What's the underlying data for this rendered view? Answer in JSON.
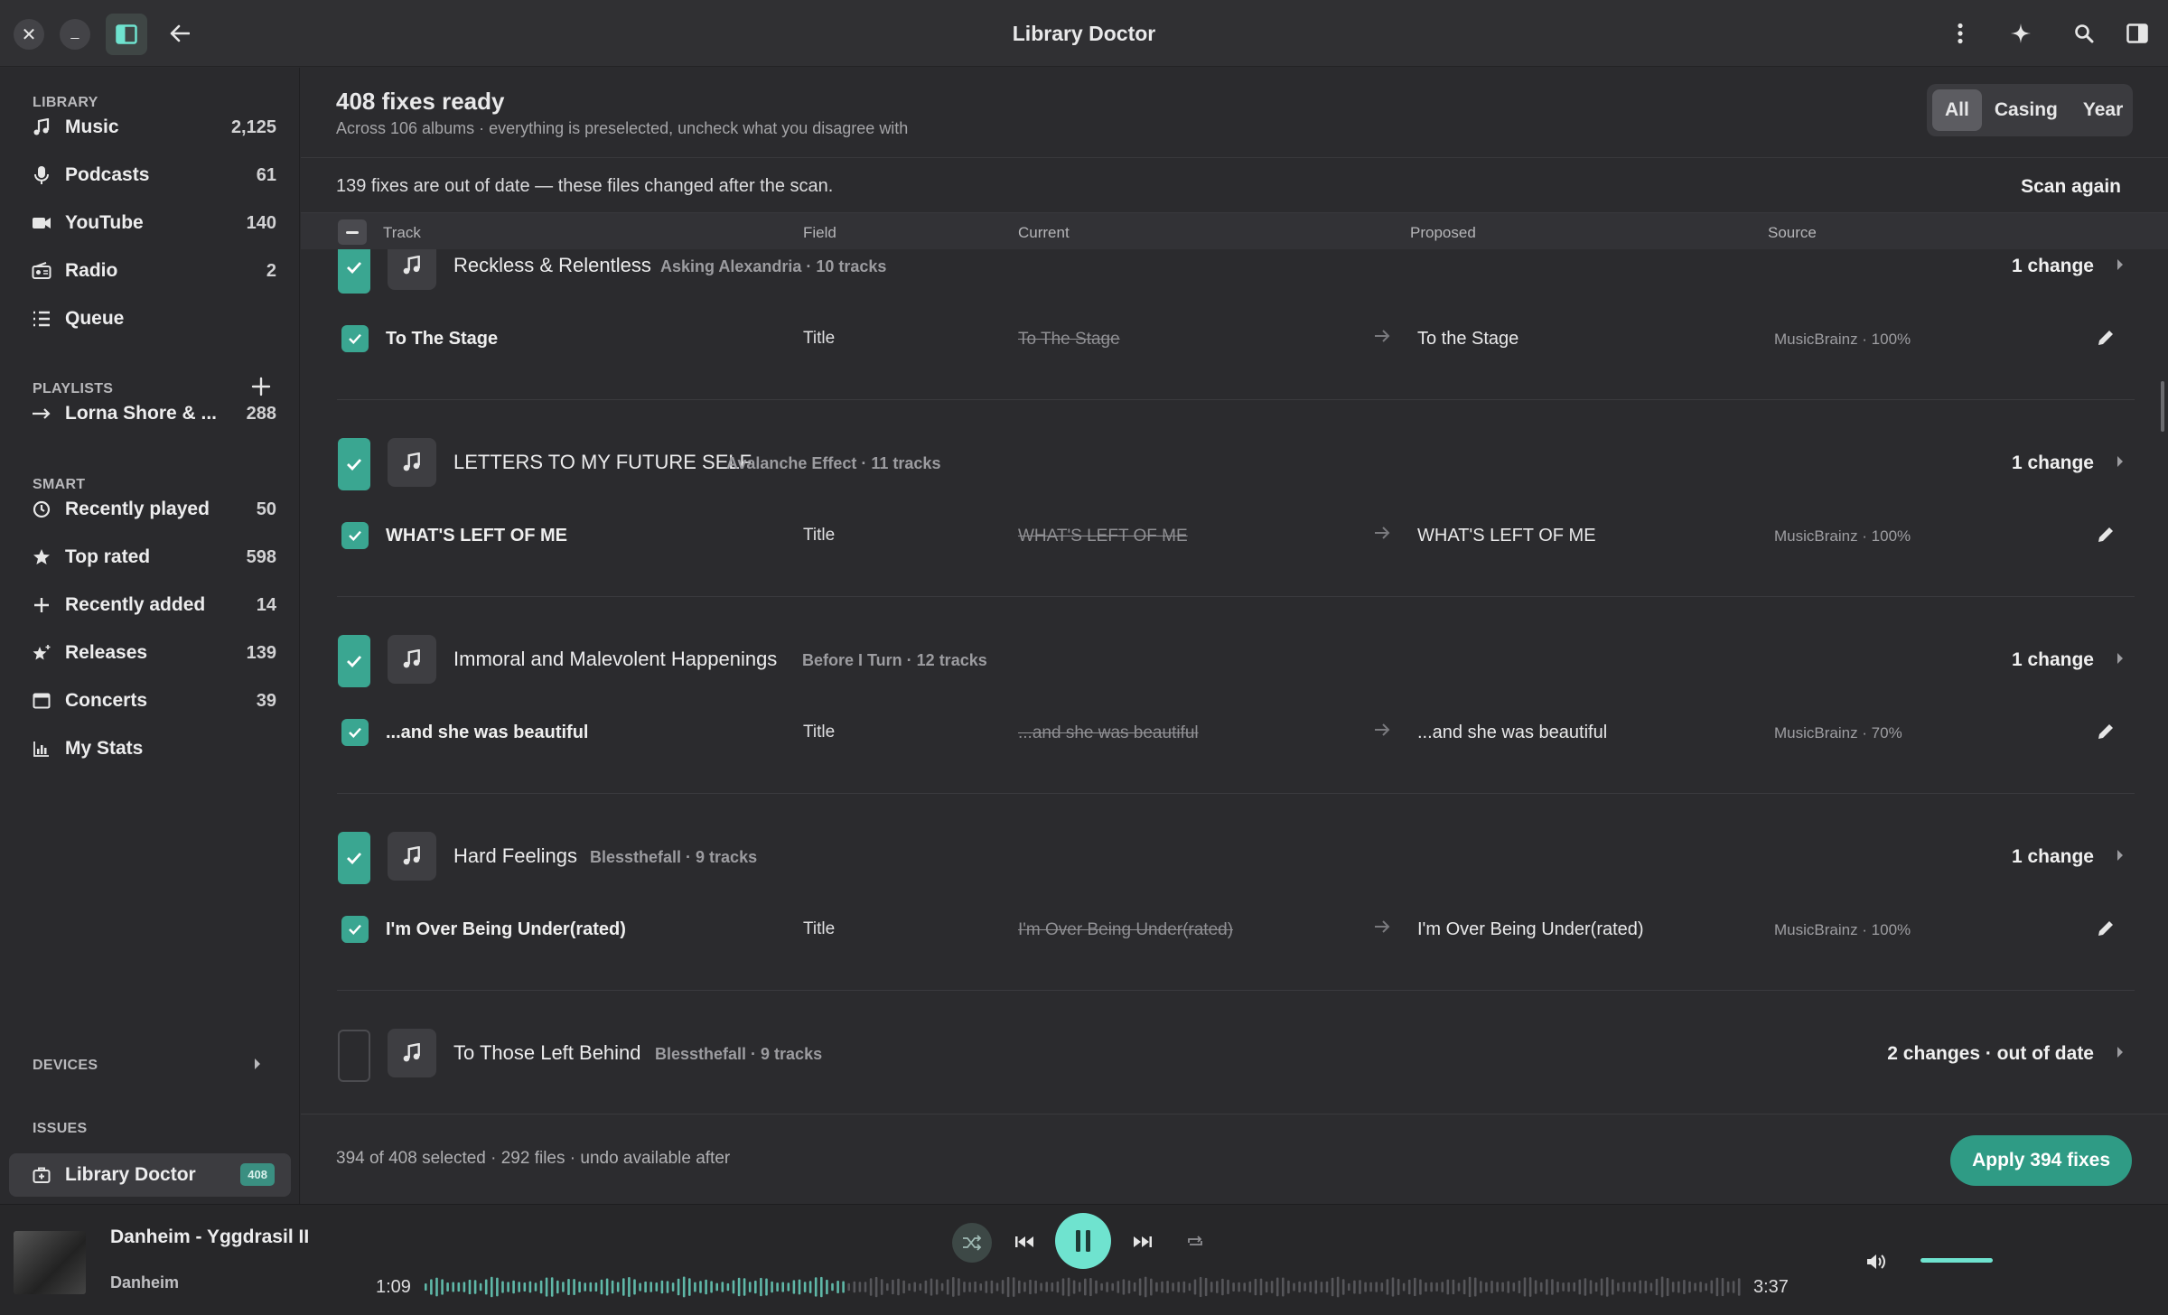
{
  "header": {
    "title": "Library Doctor"
  },
  "sidebar": {
    "library_heading": "LIBRARY",
    "library": [
      {
        "label": "Music",
        "count": "2,125",
        "icon": "music-note-icon"
      },
      {
        "label": "Podcasts",
        "count": "61",
        "icon": "microphone-icon"
      },
      {
        "label": "YouTube",
        "count": "140",
        "icon": "video-camera-icon"
      },
      {
        "label": "Radio",
        "count": "2",
        "icon": "radio-icon"
      },
      {
        "label": "Queue",
        "count": "",
        "icon": "list-icon"
      }
    ],
    "playlists_heading": "PLAYLISTS",
    "playlists": [
      {
        "label": "Lorna Shore & ...",
        "count": "288",
        "icon": "playlist-arrow-icon"
      }
    ],
    "smart_heading": "SMART",
    "smart": [
      {
        "label": "Recently played",
        "count": "50",
        "icon": "clock-icon"
      },
      {
        "label": "Top rated",
        "count": "598",
        "icon": "star-icon"
      },
      {
        "label": "Recently added",
        "count": "14",
        "icon": "plus-icon"
      },
      {
        "label": "Releases",
        "count": "139",
        "icon": "star-sparkle-icon"
      },
      {
        "label": "Concerts",
        "count": "39",
        "icon": "calendar-icon"
      },
      {
        "label": "My Stats",
        "count": "",
        "icon": "bar-chart-icon"
      }
    ],
    "devices_heading": "DEVICES",
    "issues_heading": "ISSUES",
    "issues": [
      {
        "label": "Library Doctor",
        "badge": "408",
        "icon": "doctor-bag-icon"
      }
    ]
  },
  "main": {
    "title": "408 fixes ready",
    "subtitle": "Across 106 albums · everything is preselected, uncheck what you disagree with",
    "filters": [
      "All",
      "Casing",
      "Year"
    ],
    "active_filter": "All",
    "banner_text": "139 fixes are out of date — these files changed after the scan.",
    "scan_again": "Scan again",
    "columns": {
      "track": "Track",
      "field": "Field",
      "current": "Current",
      "proposed": "Proposed",
      "source": "Source"
    },
    "albums": [
      {
        "title": "Reckless & Relentless",
        "meta": "Asking Alexandria · 10 tracks",
        "changes": "1 change",
        "checked": true,
        "tracks": [
          {
            "name": "To The Stage",
            "field": "Title",
            "current": "To The Stage",
            "proposed": "To the Stage",
            "source": "MusicBrainz · 100%"
          }
        ]
      },
      {
        "title": "LETTERS TO MY FUTURE SELF",
        "meta": "Avalanche Effect · 11 tracks",
        "changes": "1 change",
        "checked": true,
        "tracks": [
          {
            "name": "WHAT'S LEFT OF ME",
            "field": "Title",
            "current": "WHAT'S LEFT OF ME",
            "proposed": "WHAT'S LEFT OF ME",
            "source": "MusicBrainz · 100%"
          }
        ]
      },
      {
        "title": "Immoral and Malevolent Happenings",
        "meta": "Before I Turn · 12 tracks",
        "changes": "1 change",
        "checked": true,
        "tracks": [
          {
            "name": "...and she was beautiful",
            "field": "Title",
            "current": "...and she was beautiful",
            "proposed": "...and she was beautiful",
            "source": "MusicBrainz · 70%"
          }
        ]
      },
      {
        "title": "Hard Feelings",
        "meta": "Blessthefall · 9 tracks",
        "changes": "1 change",
        "checked": true,
        "tracks": [
          {
            "name": "I'm Over Being Under(rated)",
            "field": "Title",
            "current": "I'm Over Being Under(rated)",
            "proposed": "I'm Over Being Under(rated)",
            "source": "MusicBrainz · 100%"
          }
        ]
      },
      {
        "title": "To Those Left Behind",
        "meta": "Blessthefall · 9 tracks",
        "changes": "2 changes · out of date",
        "checked": false,
        "tracks": []
      }
    ],
    "footer_text": "394 of 408 selected · 292 files · undo available after",
    "apply_label": "Apply 394 fixes"
  },
  "player": {
    "title": "Danheim - Yggdrasil II",
    "artist": "Danheim",
    "elapsed": "1:09",
    "duration": "3:37",
    "progress": 0.32,
    "volume": 1.0,
    "accent": "#6fe3cf"
  }
}
